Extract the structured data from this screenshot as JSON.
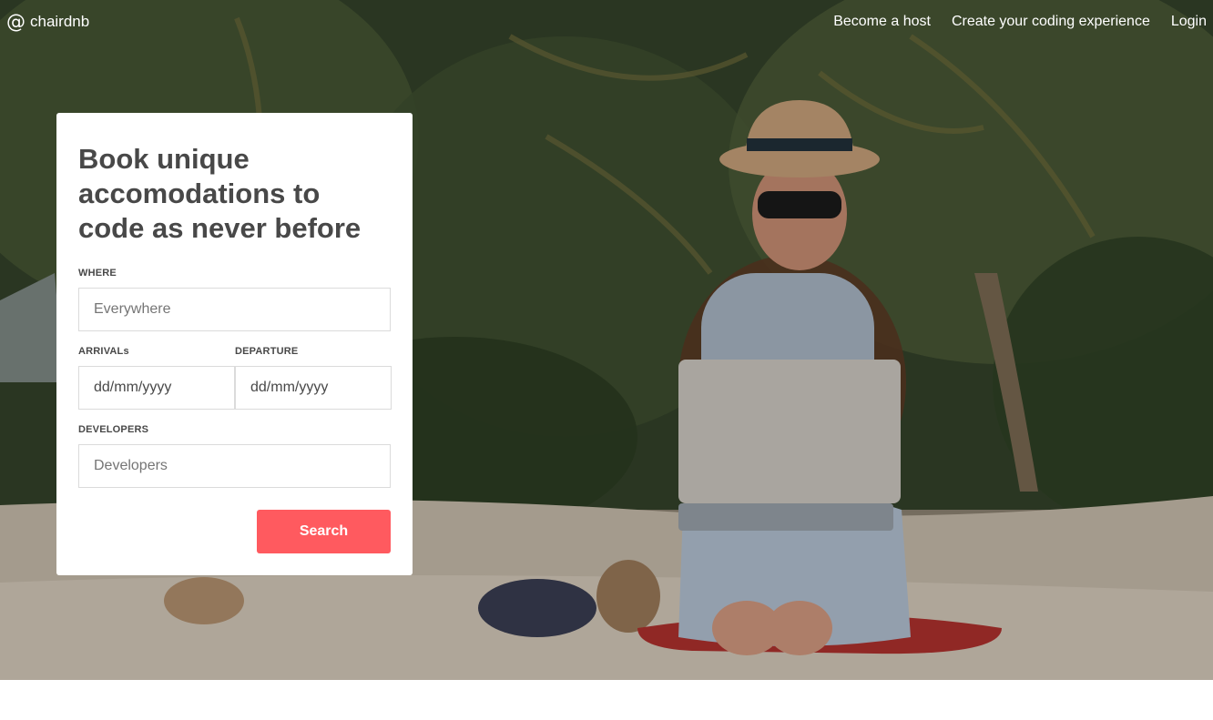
{
  "brand": {
    "icon": "@",
    "name": "chairdnb"
  },
  "nav": {
    "links": [
      {
        "label": "Become a host"
      },
      {
        "label": "Create your coding experience"
      },
      {
        "label": "Login"
      }
    ]
  },
  "hero": {
    "image": "beach-woman-with-laptop-photo"
  },
  "booking": {
    "title": "Book unique accomodations to code as never before",
    "where": {
      "label": "WHERE",
      "placeholder": "Everywhere"
    },
    "arrivals": {
      "label": "ARRIVALs",
      "value": "dd/mm/yyyy"
    },
    "departure": {
      "label": "DEPARTURE",
      "value": "dd/mm/yyyy"
    },
    "developers": {
      "label": "DEVELOPERS",
      "placeholder": "Developers"
    },
    "search_label": "Search"
  },
  "colors": {
    "accent": "#ff5a5f",
    "text": "#484848"
  }
}
